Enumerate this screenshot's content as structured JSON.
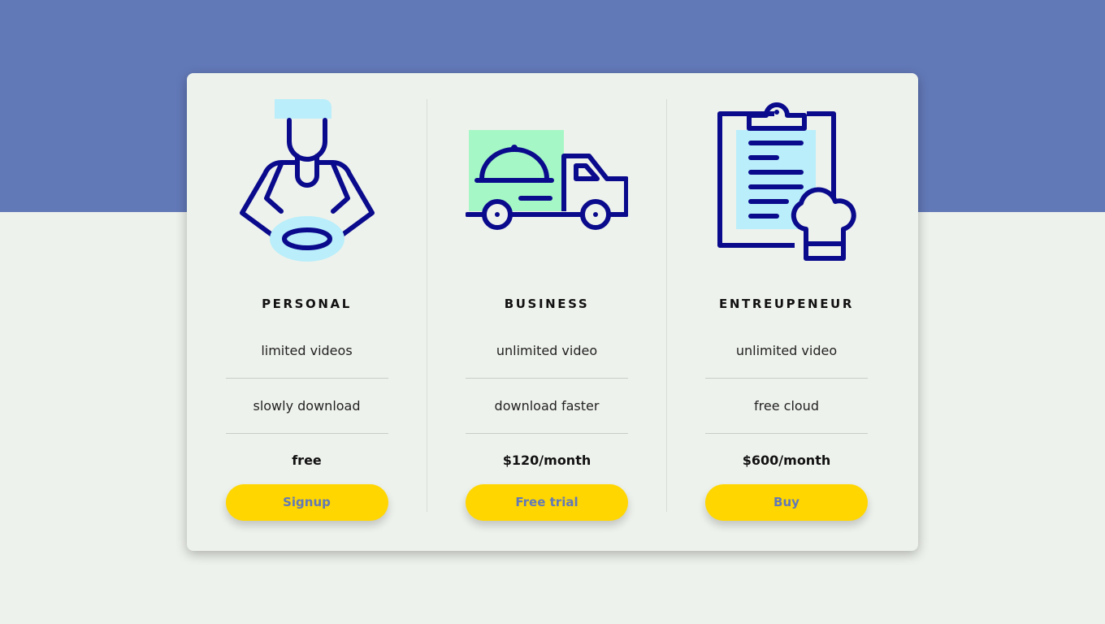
{
  "colors": {
    "band": "#6279b8",
    "background": "#eef2ec",
    "button": "#ffd600",
    "button_text": "#6279b8",
    "icon_stroke": "#0a0a8c",
    "icon_fill_blue": "#b9eefa",
    "icon_fill_green": "#a6f7c6"
  },
  "plans": [
    {
      "icon": "chef-with-plate-icon",
      "name": "PERSONAL",
      "features": [
        "limited videos",
        "slowly download"
      ],
      "price": "free",
      "cta": "Signup"
    },
    {
      "icon": "delivery-truck-icon",
      "name": "BUSINESS",
      "features": [
        "unlimited video",
        "download faster"
      ],
      "price": "$120/month",
      "cta": "Free trial"
    },
    {
      "icon": "clipboard-chef-hat-icon",
      "name": "ENTREUPENEUR",
      "features": [
        "unlimited video",
        "free cloud"
      ],
      "price": "$600/month",
      "cta": "Buy"
    }
  ]
}
